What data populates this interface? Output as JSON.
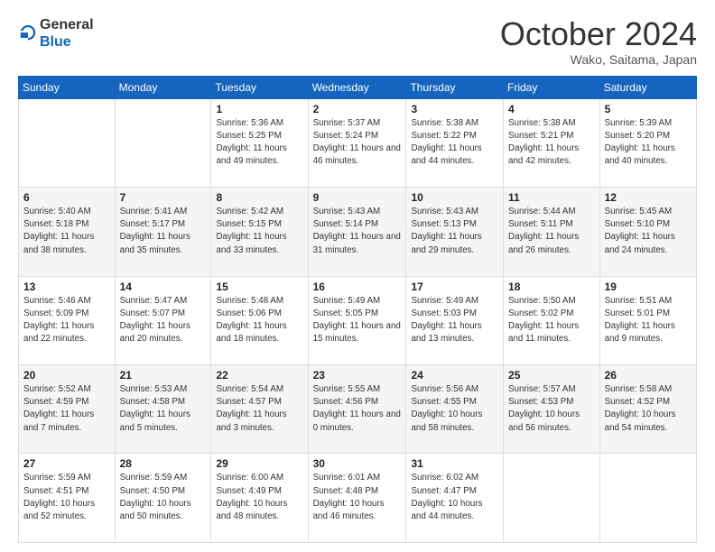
{
  "header": {
    "logo_line1": "General",
    "logo_line2": "Blue",
    "month": "October 2024",
    "location": "Wako, Saitama, Japan"
  },
  "weekdays": [
    "Sunday",
    "Monday",
    "Tuesday",
    "Wednesday",
    "Thursday",
    "Friday",
    "Saturday"
  ],
  "weeks": [
    [
      {
        "day": "",
        "info": ""
      },
      {
        "day": "",
        "info": ""
      },
      {
        "day": "1",
        "info": "Sunrise: 5:36 AM\nSunset: 5:25 PM\nDaylight: 11 hours and 49 minutes."
      },
      {
        "day": "2",
        "info": "Sunrise: 5:37 AM\nSunset: 5:24 PM\nDaylight: 11 hours and 46 minutes."
      },
      {
        "day": "3",
        "info": "Sunrise: 5:38 AM\nSunset: 5:22 PM\nDaylight: 11 hours and 44 minutes."
      },
      {
        "day": "4",
        "info": "Sunrise: 5:38 AM\nSunset: 5:21 PM\nDaylight: 11 hours and 42 minutes."
      },
      {
        "day": "5",
        "info": "Sunrise: 5:39 AM\nSunset: 5:20 PM\nDaylight: 11 hours and 40 minutes."
      }
    ],
    [
      {
        "day": "6",
        "info": "Sunrise: 5:40 AM\nSunset: 5:18 PM\nDaylight: 11 hours and 38 minutes."
      },
      {
        "day": "7",
        "info": "Sunrise: 5:41 AM\nSunset: 5:17 PM\nDaylight: 11 hours and 35 minutes."
      },
      {
        "day": "8",
        "info": "Sunrise: 5:42 AM\nSunset: 5:15 PM\nDaylight: 11 hours and 33 minutes."
      },
      {
        "day": "9",
        "info": "Sunrise: 5:43 AM\nSunset: 5:14 PM\nDaylight: 11 hours and 31 minutes."
      },
      {
        "day": "10",
        "info": "Sunrise: 5:43 AM\nSunset: 5:13 PM\nDaylight: 11 hours and 29 minutes."
      },
      {
        "day": "11",
        "info": "Sunrise: 5:44 AM\nSunset: 5:11 PM\nDaylight: 11 hours and 26 minutes."
      },
      {
        "day": "12",
        "info": "Sunrise: 5:45 AM\nSunset: 5:10 PM\nDaylight: 11 hours and 24 minutes."
      }
    ],
    [
      {
        "day": "13",
        "info": "Sunrise: 5:46 AM\nSunset: 5:09 PM\nDaylight: 11 hours and 22 minutes."
      },
      {
        "day": "14",
        "info": "Sunrise: 5:47 AM\nSunset: 5:07 PM\nDaylight: 11 hours and 20 minutes."
      },
      {
        "day": "15",
        "info": "Sunrise: 5:48 AM\nSunset: 5:06 PM\nDaylight: 11 hours and 18 minutes."
      },
      {
        "day": "16",
        "info": "Sunrise: 5:49 AM\nSunset: 5:05 PM\nDaylight: 11 hours and 15 minutes."
      },
      {
        "day": "17",
        "info": "Sunrise: 5:49 AM\nSunset: 5:03 PM\nDaylight: 11 hours and 13 minutes."
      },
      {
        "day": "18",
        "info": "Sunrise: 5:50 AM\nSunset: 5:02 PM\nDaylight: 11 hours and 11 minutes."
      },
      {
        "day": "19",
        "info": "Sunrise: 5:51 AM\nSunset: 5:01 PM\nDaylight: 11 hours and 9 minutes."
      }
    ],
    [
      {
        "day": "20",
        "info": "Sunrise: 5:52 AM\nSunset: 4:59 PM\nDaylight: 11 hours and 7 minutes."
      },
      {
        "day": "21",
        "info": "Sunrise: 5:53 AM\nSunset: 4:58 PM\nDaylight: 11 hours and 5 minutes."
      },
      {
        "day": "22",
        "info": "Sunrise: 5:54 AM\nSunset: 4:57 PM\nDaylight: 11 hours and 3 minutes."
      },
      {
        "day": "23",
        "info": "Sunrise: 5:55 AM\nSunset: 4:56 PM\nDaylight: 11 hours and 0 minutes."
      },
      {
        "day": "24",
        "info": "Sunrise: 5:56 AM\nSunset: 4:55 PM\nDaylight: 10 hours and 58 minutes."
      },
      {
        "day": "25",
        "info": "Sunrise: 5:57 AM\nSunset: 4:53 PM\nDaylight: 10 hours and 56 minutes."
      },
      {
        "day": "26",
        "info": "Sunrise: 5:58 AM\nSunset: 4:52 PM\nDaylight: 10 hours and 54 minutes."
      }
    ],
    [
      {
        "day": "27",
        "info": "Sunrise: 5:59 AM\nSunset: 4:51 PM\nDaylight: 10 hours and 52 minutes."
      },
      {
        "day": "28",
        "info": "Sunrise: 5:59 AM\nSunset: 4:50 PM\nDaylight: 10 hours and 50 minutes."
      },
      {
        "day": "29",
        "info": "Sunrise: 6:00 AM\nSunset: 4:49 PM\nDaylight: 10 hours and 48 minutes."
      },
      {
        "day": "30",
        "info": "Sunrise: 6:01 AM\nSunset: 4:48 PM\nDaylight: 10 hours and 46 minutes."
      },
      {
        "day": "31",
        "info": "Sunrise: 6:02 AM\nSunset: 4:47 PM\nDaylight: 10 hours and 44 minutes."
      },
      {
        "day": "",
        "info": ""
      },
      {
        "day": "",
        "info": ""
      }
    ]
  ]
}
